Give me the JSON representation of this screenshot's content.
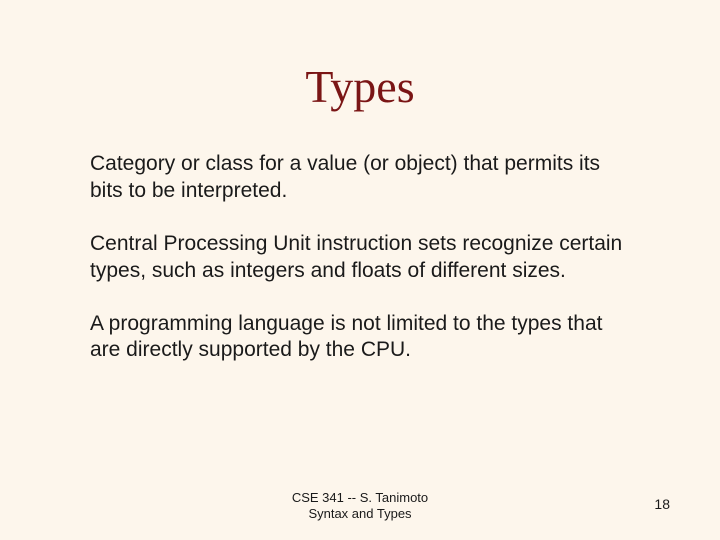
{
  "slide": {
    "title": "Types",
    "paragraphs": [
      "Category or class for a value (or object) that permits its bits to be interpreted.",
      "Central Processing Unit instruction sets recognize certain types, such as integers and floats of different sizes.",
      "A programming language is not limited to the types that are directly supported by the CPU."
    ],
    "footer": {
      "line1": "CSE 341 -- S. Tanimoto",
      "line2": "Syntax and Types"
    },
    "page_number": "18"
  }
}
